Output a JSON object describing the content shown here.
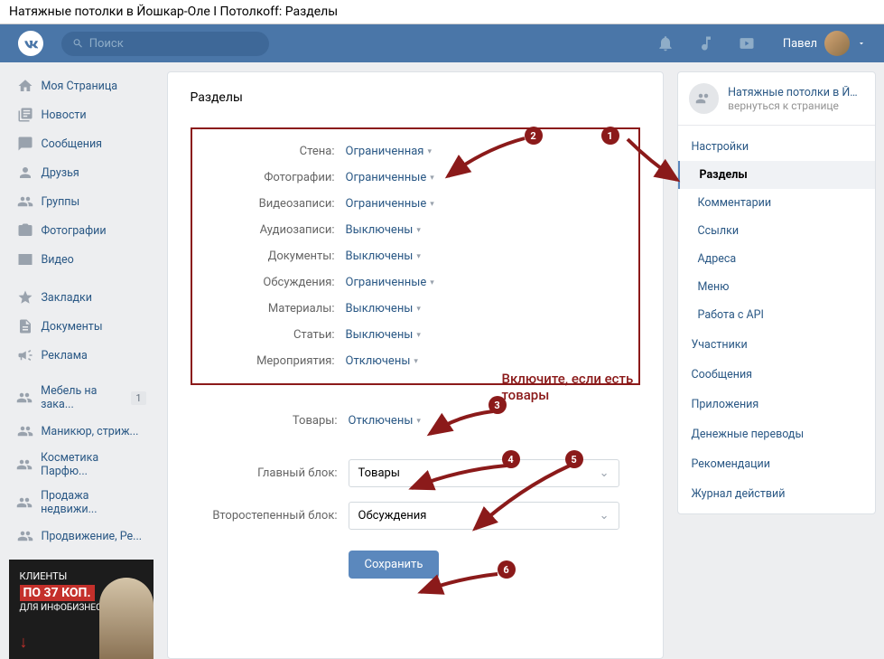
{
  "page_title": "Натяжные потолки в Йошкар-Оле І Потолкоff: Разделы",
  "search_placeholder": "Поиск",
  "user_name": "Павел",
  "left_nav": {
    "main": [
      {
        "label": "Моя Страница",
        "icon": "home"
      },
      {
        "label": "Новости",
        "icon": "news"
      },
      {
        "label": "Сообщения",
        "icon": "messages"
      },
      {
        "label": "Друзья",
        "icon": "friends"
      },
      {
        "label": "Группы",
        "icon": "groups"
      },
      {
        "label": "Фотографии",
        "icon": "photos"
      },
      {
        "label": "Видео",
        "icon": "video"
      }
    ],
    "secondary": [
      {
        "label": "Закладки",
        "icon": "bookmark"
      },
      {
        "label": "Документы",
        "icon": "docs"
      },
      {
        "label": "Реклама",
        "icon": "ads"
      }
    ],
    "groups": [
      {
        "label": "Мебель на зака...",
        "badge": "1"
      },
      {
        "label": "Маникюр, стриж..."
      },
      {
        "label": "Косметика Парфю..."
      },
      {
        "label": "Продажа недвижи..."
      },
      {
        "label": "Продвижение, Ре..."
      }
    ]
  },
  "ad": {
    "title": "КЛИЕНТЫ",
    "highlight": "ПО 37 КОП.",
    "sub": "ДЛЯ ИНФОБИЗНЕСА"
  },
  "content": {
    "heading": "Разделы",
    "settings": [
      {
        "label": "Стена:",
        "value": "Ограниченная"
      },
      {
        "label": "Фотографии:",
        "value": "Ограниченные"
      },
      {
        "label": "Видеозаписи:",
        "value": "Ограниченные"
      },
      {
        "label": "Аудиозаписи:",
        "value": "Выключены"
      },
      {
        "label": "Документы:",
        "value": "Выключены"
      },
      {
        "label": "Обсуждения:",
        "value": "Ограниченные"
      },
      {
        "label": "Материалы:",
        "value": "Выключены"
      },
      {
        "label": "Статьи:",
        "value": "Выключены"
      },
      {
        "label": "Мероприятия:",
        "value": "Отключены"
      }
    ],
    "products_label": "Товары:",
    "products_value": "Отключены",
    "main_block_label": "Главный блок:",
    "main_block_value": "Товары",
    "secondary_block_label": "Второстепенный блок:",
    "secondary_block_value": "Обсуждения",
    "save_button": "Сохранить"
  },
  "right": {
    "group_title": "Натяжные потолки в Йо...",
    "group_return": "вернуться к странице",
    "menu": [
      {
        "label": "Настройки",
        "type": "head"
      },
      {
        "label": "Разделы",
        "type": "sub",
        "active": true
      },
      {
        "label": "Комментарии",
        "type": "sub"
      },
      {
        "label": "Ссылки",
        "type": "sub"
      },
      {
        "label": "Адреса",
        "type": "sub"
      },
      {
        "label": "Меню",
        "type": "sub"
      },
      {
        "label": "Работа с API",
        "type": "sub"
      },
      {
        "label": "Участники",
        "type": "head"
      },
      {
        "label": "Сообщения",
        "type": "head"
      },
      {
        "label": "Приложения",
        "type": "head"
      },
      {
        "label": "Денежные переводы",
        "type": "head"
      },
      {
        "label": "Рекомендации",
        "type": "head"
      },
      {
        "label": "Журнал действий",
        "type": "head"
      }
    ]
  },
  "annotations": {
    "b1": "1",
    "b2": "2",
    "b3": "3",
    "b4": "4",
    "b5": "5",
    "b6": "6",
    "text": "Включите, если есть товары"
  }
}
